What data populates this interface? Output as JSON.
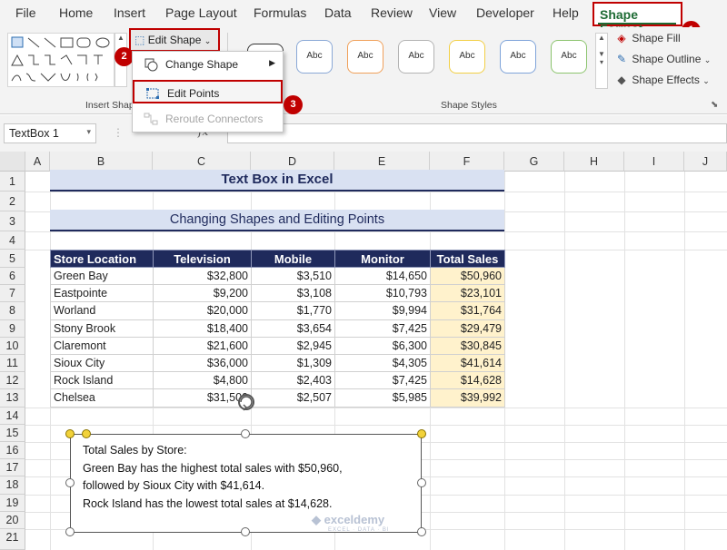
{
  "tabs": [
    "File",
    "Home",
    "Insert",
    "Page Layout",
    "Formulas",
    "Data",
    "Review",
    "View",
    "Developer",
    "Help"
  ],
  "active_tab": "Shape Format",
  "badges": [
    "1",
    "2",
    "3"
  ],
  "ribbon": {
    "insert_shapes_label": "Insert Shap",
    "edit_shape": "Edit Shape",
    "shape_styles_label": "Shape Styles",
    "style_text": "Abc",
    "shape_fill": "Shape Fill",
    "shape_outline": "Shape Outline",
    "shape_effects": "Shape Effects"
  },
  "dropdown": {
    "change_shape": "Change Shape",
    "edit_points": "Edit Points",
    "reroute": "Reroute Connectors"
  },
  "formula_bar": {
    "name_box": "TextBox 1",
    "fx": "fx",
    "value": ""
  },
  "columns": [
    "A",
    "B",
    "C",
    "D",
    "E",
    "F",
    "G",
    "H",
    "I",
    "J"
  ],
  "rows": [
    "1",
    "2",
    "3",
    "4",
    "5",
    "6",
    "7",
    "8",
    "9",
    "10",
    "11",
    "12",
    "13",
    "14",
    "15",
    "16",
    "17",
    "18",
    "19",
    "20",
    "21"
  ],
  "title": "Text Box in Excel",
  "subtitle": "Changing Shapes and Editing Points",
  "table": {
    "headers": [
      "Store Location",
      "Television",
      "Mobile",
      "Monitor",
      "Total Sales"
    ],
    "rows": [
      [
        "Green Bay",
        "$32,800",
        "$3,510",
        "$14,650",
        "$50,960"
      ],
      [
        "Eastpointe",
        "$9,200",
        "$3,108",
        "$10,793",
        "$23,101"
      ],
      [
        "Worland",
        "$20,000",
        "$1,770",
        "$9,994",
        "$31,764"
      ],
      [
        "Stony Brook",
        "$18,400",
        "$3,654",
        "$7,425",
        "$29,479"
      ],
      [
        "Claremont",
        "$21,600",
        "$2,945",
        "$6,300",
        "$30,845"
      ],
      [
        "Sioux City",
        "$36,000",
        "$1,309",
        "$4,305",
        "$41,614"
      ],
      [
        "Rock Island",
        "$4,800",
        "$2,403",
        "$7,425",
        "$14,628"
      ],
      [
        "Chelsea",
        "$31,500",
        "$2,507",
        "$5,985",
        "$39,992"
      ]
    ]
  },
  "textbox_lines": [
    "Total Sales by Store:",
    "Green Bay has the highest total sales with $50,960,",
    "followed by Sioux City with $41,614.",
    "Rock Island has the lowest total sales at $14,628."
  ],
  "watermark": {
    "name": "exceldemy",
    "tagline": "EXCEL · DATA · BI"
  }
}
